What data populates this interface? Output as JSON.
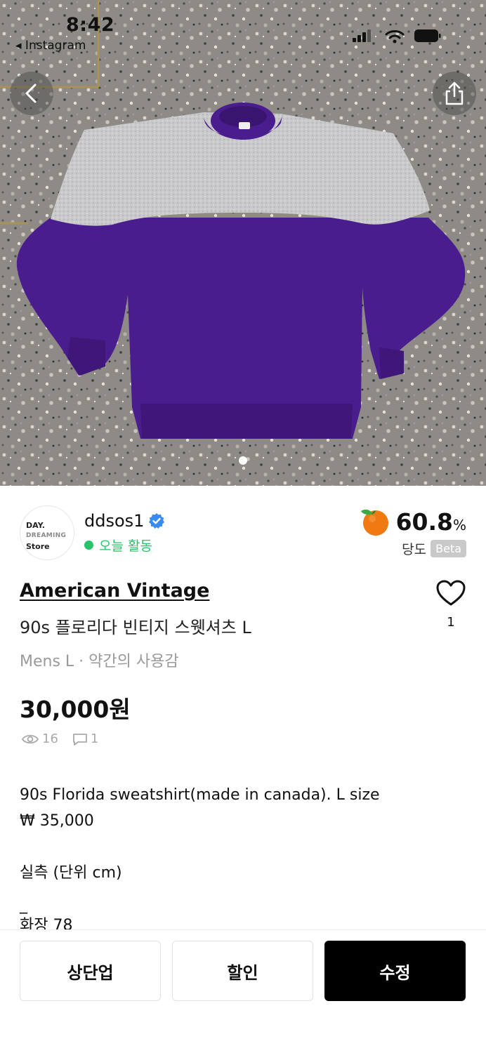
{
  "status_bar": {
    "time": "8:42",
    "back_app": "◂ Instagram"
  },
  "hero": {
    "image_description_icon": "product-photo",
    "page_count": 2,
    "active_page": 1
  },
  "seller": {
    "avatar_text_top": "DAY.",
    "avatar_text_mid": "DREAMING",
    "avatar_text_bottom": "Store",
    "name": "ddsos1",
    "activity": "오늘 활동",
    "score": "60.8",
    "score_unit": "%",
    "score_label": "당도",
    "score_badge": "Beta"
  },
  "product": {
    "brand": "American Vintage",
    "title": "90s 플로리다 빈티지 스웻셔츠 L",
    "meta": "Mens L · 약간의 사용감",
    "likes": "1",
    "price": "30,000원",
    "views": "16",
    "comments": "1"
  },
  "description": {
    "line1": "90s Florida sweatshirt(made in canada). L size",
    "line2": "₩ 35,000",
    "line3": "실측 (단위 cm)",
    "line4": "_",
    "line5": "화장 78"
  },
  "actions": {
    "bump": "상단업",
    "discount": "할인",
    "edit": "수정"
  },
  "colors": {
    "accent_green": "#27c46b",
    "verify_blue": "#3a8bf0",
    "primary_button": "#000000"
  }
}
